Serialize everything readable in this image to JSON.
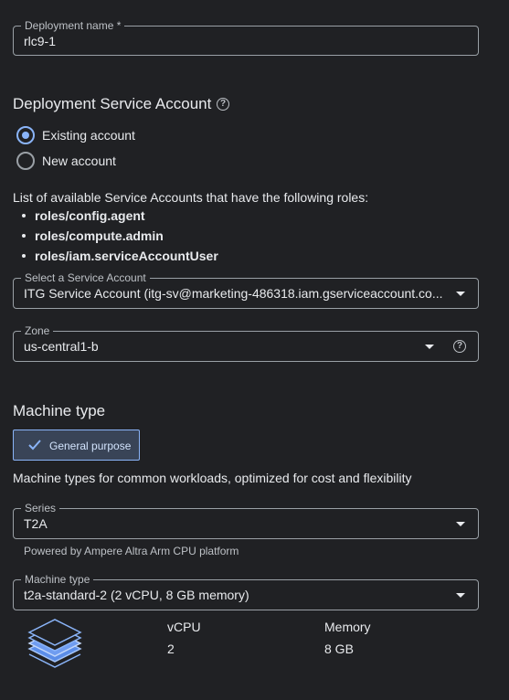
{
  "deployment_name": {
    "label": "Deployment name *",
    "value": "rlc9-1"
  },
  "service_account_section": {
    "title": "Deployment Service Account",
    "help_icon": "help-circle-icon",
    "options": [
      {
        "label": "Existing account",
        "selected": true
      },
      {
        "label": "New account",
        "selected": false
      }
    ],
    "roles_intro": "List of available Service Accounts that have the following roles:",
    "roles": [
      "roles/config.agent",
      "roles/compute.admin",
      "roles/iam.serviceAccountUser"
    ],
    "select": {
      "label": "Select a Service Account",
      "value": "ITG Service Account (itg-sv@marketing-486318.iam.gserviceaccount.co..."
    }
  },
  "zone": {
    "label": "Zone",
    "value": "us-central1-b",
    "help_icon": "help-circle-icon"
  },
  "machine_type_section": {
    "title": "Machine type",
    "chip": {
      "label": "General purpose",
      "selected": true,
      "icon": "check-icon"
    },
    "description": "Machine types for common workloads, optimized for cost and flexibility",
    "series": {
      "label": "Series",
      "value": "T2A",
      "hint": "Powered by Ampere Altra Arm CPU platform"
    },
    "machine_type": {
      "label": "Machine type",
      "value": "t2a-standard-2 (2 vCPU, 8 GB memory)"
    },
    "summary": {
      "icon": "layers-stack-icon",
      "vcpu_label": "vCPU",
      "vcpu_value": "2",
      "memory_label": "Memory",
      "memory_value": "8 GB"
    }
  },
  "colors": {
    "background": "#202124",
    "accent": "#8ab4f8",
    "text": "#e8eaed",
    "outline": "#9aa0a6"
  }
}
